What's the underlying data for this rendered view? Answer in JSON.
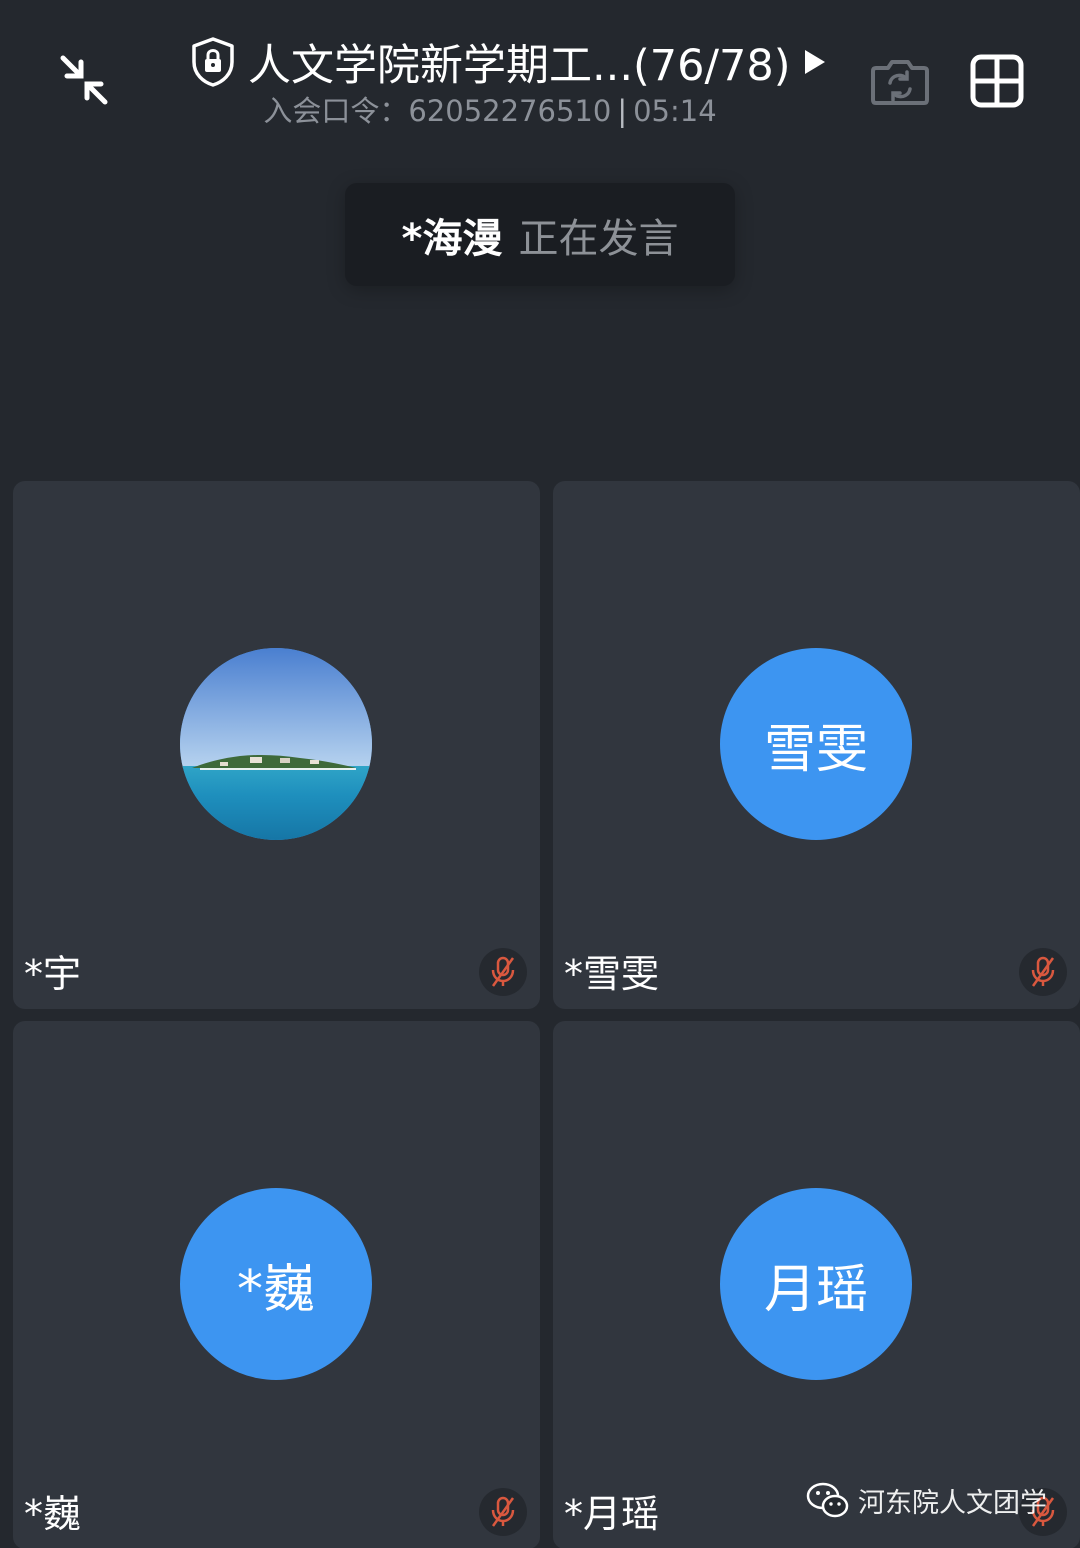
{
  "header": {
    "meeting_title": "人文学院新学期工...(76/78)",
    "join_code_label": "入会口令：",
    "join_code": "62052276510",
    "separator": "|",
    "elapsed_time": "05:14",
    "icons": {
      "collapse": "collapse-arrows-icon",
      "lock": "shield-lock-icon",
      "play": "play-triangle-icon",
      "camera_switch": "camera-switch-icon",
      "layout": "grid-layout-icon"
    }
  },
  "speaking": {
    "speaker": "*海漫",
    "status": "正在发言"
  },
  "participants": [
    {
      "name": "*宇",
      "avatar_type": "photo",
      "avatar_desc": "sea-island-photo",
      "muted": true
    },
    {
      "name": "*雪雯",
      "avatar_type": "text",
      "avatar_text": "雪雯",
      "muted": true
    },
    {
      "name": "*巍",
      "avatar_type": "text",
      "avatar_text": "*巍",
      "muted": true
    },
    {
      "name": "*月瑶",
      "avatar_type": "text",
      "avatar_text": "月瑶",
      "muted": true
    }
  ],
  "watermark": {
    "text": "河东院人文团学"
  },
  "colors": {
    "background": "#24282e",
    "tile": "#31363e",
    "avatar_blue": "#3d95f1",
    "muted_red": "#d9583f",
    "banner": "#1a1d22"
  }
}
